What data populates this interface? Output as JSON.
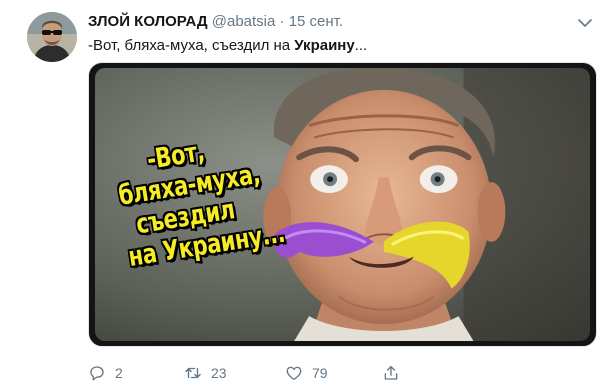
{
  "tweet": {
    "display_name": "ЗЛОЙ КОЛОРАД",
    "handle": "@abatsia",
    "separator": "·",
    "date": "15 сент.",
    "text_plain": "-Вот, бляха-муха, съездил на ",
    "text_bold": "Украину",
    "text_tail": "..."
  },
  "media": {
    "caption_lines": [
      "-Вот,",
      "бляха-муха,",
      "съездил",
      "на Украину..."
    ],
    "caption_color": "#f5ec25"
  },
  "actions": {
    "reply_count": "2",
    "retweet_count": "23",
    "like_count": "79"
  },
  "colors": {
    "muted": "#657786",
    "text": "#14171a",
    "border": "#e1e8ed"
  },
  "icons": {
    "reply": "reply-icon",
    "retweet": "retweet-icon",
    "like": "heart-icon",
    "share": "share-icon",
    "more": "chevron-down-icon"
  }
}
